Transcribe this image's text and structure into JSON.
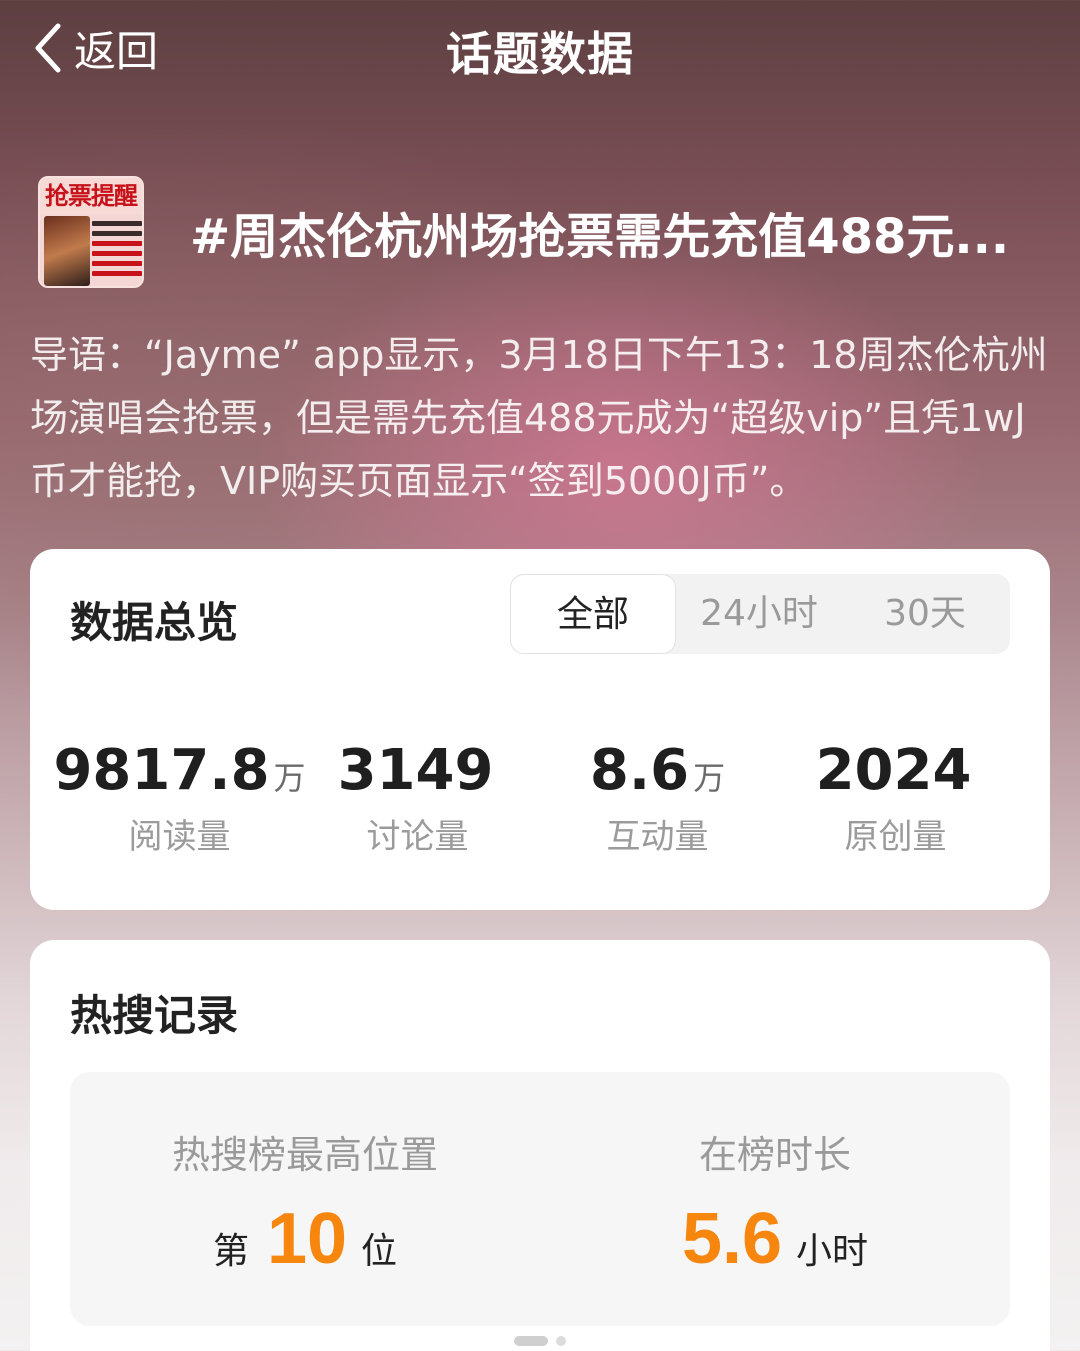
{
  "nav": {
    "back_label": "返回",
    "title": "话题数据"
  },
  "topic": {
    "thumb_text": "抢票提醒",
    "title": "#周杰伦杭州场抢票需先充值488元...",
    "intro": "导语：“Jayme” app显示，3月18日下午13：18周杰伦杭州场演唱会抢票，但是需先充值488元成为“超级vip”且凭1wJ币才能抢，VIP购买页面显示“签到5000J币”。"
  },
  "overview": {
    "title": "数据总览",
    "tabs": [
      {
        "label": "全部",
        "active": true
      },
      {
        "label": "24小时",
        "active": false
      },
      {
        "label": "30天",
        "active": false
      }
    ],
    "stats": [
      {
        "value": "9817.8",
        "unit": "万",
        "label": "阅读量"
      },
      {
        "value": "3149",
        "unit": "",
        "label": "讨论量"
      },
      {
        "value": "8.6",
        "unit": "万",
        "label": "互动量"
      },
      {
        "value": "2024",
        "unit": "",
        "label": "原创量"
      }
    ]
  },
  "hot": {
    "title": "热搜记录",
    "rank": {
      "label": "热搜榜最高位置",
      "prefix": "第",
      "value": "10",
      "suffix": "位"
    },
    "duration": {
      "label": "在榜时长",
      "value": "5.6",
      "suffix": "小时"
    }
  },
  "colors": {
    "accent": "#f7860f",
    "card_bg": "#ffffff"
  }
}
